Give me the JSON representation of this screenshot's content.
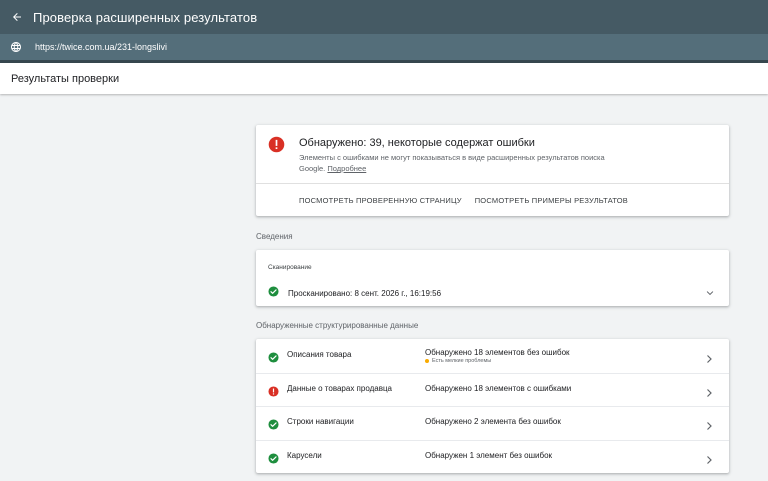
{
  "header": {
    "title": "Проверка расширенных результатов",
    "back_icon": "arrow-back-icon"
  },
  "urlbar": {
    "url": "https://twice.com.ua/231-longslivi",
    "icon": "globe-icon"
  },
  "subheader": {
    "title": "Результаты проверки"
  },
  "summary": {
    "title": "Обнаружено: 39, некоторые содержат ошибки",
    "description": "Элементы с ошибками не могут показываться в виде расширенных результатов поиска Google.",
    "more_link": "Подробнее",
    "view_page_button": "ПОСМОТРЕТЬ ПРОВЕРЕННУЮ СТРАНИЦУ",
    "view_examples_button": "ПОСМОТРЕТЬ ПРИМЕРЫ РЕЗУЛЬТАТОВ",
    "status_color": "#d93025"
  },
  "details": {
    "section_label": "Сведения",
    "crawl_label": "Сканирование",
    "crawled_text": "Просканировано: 8 сент. 2026 г., 16:19:56"
  },
  "structured": {
    "section_label": "Обнаруженные структурированные данные",
    "items": [
      {
        "name": "Описания товара",
        "status": "Обнаружено 18 элементов без ошибок",
        "warning": "Есть мелкие проблемы",
        "state": "ok"
      },
      {
        "name": "Данные о товарах продавца",
        "status": "Обнаружено 18 элементов с ошибками",
        "state": "error"
      },
      {
        "name": "Строки навигации",
        "status": "Обнаружено 2 элемента без ошибок",
        "state": "ok"
      },
      {
        "name": "Карусели",
        "status": "Обнаружен 1 элемент без ошибок",
        "state": "ok"
      }
    ]
  },
  "colors": {
    "topbar": "#455a64",
    "urlbar": "#546e7a",
    "ok_green": "#1e8e3e",
    "error_red": "#d93025",
    "warning_yellow": "#f9ab00"
  }
}
